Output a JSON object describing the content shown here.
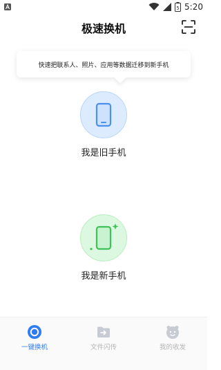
{
  "status_bar": {
    "time": "5:20",
    "battery_level": "5"
  },
  "header": {
    "title": "极速换机"
  },
  "tip": {
    "text": "快速把联系人、照片、应用等数据迁移到新手机"
  },
  "options": [
    {
      "label": "我是旧手机",
      "icon": "old-phone-icon",
      "color": "#4a90f0"
    },
    {
      "label": "我是新手机",
      "icon": "new-phone-icon",
      "color": "#3ec25a"
    }
  ],
  "bottom_nav": [
    {
      "label": "一键换机",
      "icon": "one-key-switch-icon",
      "active": true
    },
    {
      "label": "文件闪传",
      "icon": "file-transfer-icon",
      "active": false
    },
    {
      "label": "我的收发",
      "icon": "my-transfers-icon",
      "active": false
    }
  ]
}
